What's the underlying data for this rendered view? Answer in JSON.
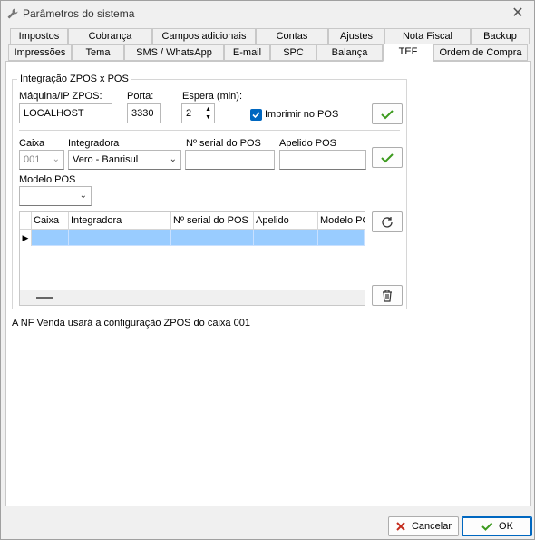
{
  "window": {
    "title": "Parâmetros do sistema"
  },
  "tabs": {
    "row1": [
      "Impostos",
      "Cobrança",
      "Campos adicionais",
      "Contas",
      "Ajustes",
      "Nota Fiscal",
      "Backup"
    ],
    "row2": [
      "Impressões",
      "Tema",
      "SMS / WhatsApp",
      "E-mail",
      "SPC",
      "Balança",
      "TEF",
      "Ordem de Compra"
    ],
    "active": "TEF"
  },
  "zpos": {
    "group_title": "Integração ZPOS x POS",
    "machine_label": "Máquina/IP ZPOS:",
    "machine_value": "LOCALHOST",
    "port_label": "Porta:",
    "port_value": "3330",
    "wait_label": "Espera (min):",
    "wait_value": "2",
    "print_label": "Imprimir no POS",
    "print_checked": true
  },
  "pos_form": {
    "caixa_label": "Caixa",
    "caixa_value": "001",
    "integradora_label": "Integradora",
    "integradora_value": "Vero - Banrisul",
    "serial_label": "Nº serial do POS",
    "serial_value": "",
    "apelido_label": "Apelido POS",
    "apelido_value": "",
    "modelo_label": "Modelo POS",
    "modelo_value": ""
  },
  "grid": {
    "columns": [
      "Caixa",
      "Integradora",
      "Nº serial do POS",
      "Apelido",
      "Modelo PO"
    ],
    "rows": [
      [
        "",
        "",
        "",
        "",
        ""
      ]
    ]
  },
  "status_text": "A NF Venda usará a configuração ZPOS do caixa 001",
  "buttons": {
    "cancel": "Cancelar",
    "ok": "OK"
  },
  "colors": {
    "accent": "#0067c0",
    "check_green": "#3c9a1e",
    "cancel_red": "#c42b1c",
    "row_selected": "#99ccff"
  }
}
